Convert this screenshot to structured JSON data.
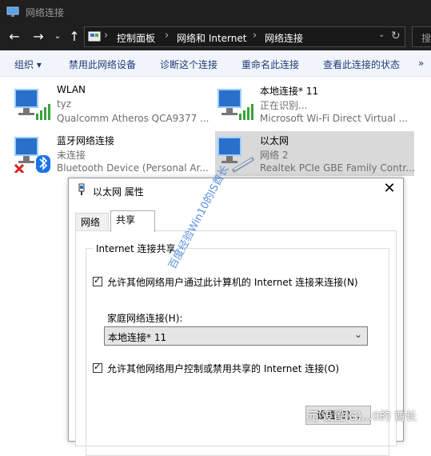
{
  "window": {
    "title": "网络连接"
  },
  "address": {
    "crumbs": [
      "控制面板",
      "网络和 Internet",
      "网络连接"
    ],
    "search_partial": "搜"
  },
  "commands": [
    "组织 ▾",
    "禁用此网络设备",
    "诊断这个连接",
    "重命名此连接",
    "查看此连接的状态",
    "»"
  ],
  "connections": [
    {
      "name": "WLAN",
      "status": "tyz",
      "device": "Qualcomm Atheros QCA9377 ...",
      "icon": "wifi-network-icon"
    },
    {
      "name": "本地连接* 11",
      "status": "正在识别...",
      "device": "Microsoft Wi-Fi Direct Virtual ...",
      "icon": "wifi-network-icon"
    },
    {
      "name": "蓝牙网络连接",
      "status": "未连接",
      "device": "Bluetooth Device (Personal Ar...",
      "icon": "bluetooth-network-icon"
    },
    {
      "name": "以太网",
      "status": "网络  2",
      "device": "Realtek PCIe GBE Family Contr...",
      "icon": "ethernet-network-icon"
    }
  ],
  "dialog": {
    "title": "以太网 属性",
    "tabs": [
      "网络",
      "共享"
    ],
    "group_title": "Internet 连接共享",
    "check1": "允许其他网络用户通过此计算机的 Internet 连接来连接(N)",
    "home_label": "家庭网络连接(H):",
    "home_value": "本地连接* 11",
    "check2": "允许其他网络用户控制或禁用共享的 Internet 连接(O)",
    "settings_button": "设置(G)..."
  },
  "watermark": "百度经验Win10的IS酋长",
  "watermark2": "元    设置(G)...0的    酋长"
}
